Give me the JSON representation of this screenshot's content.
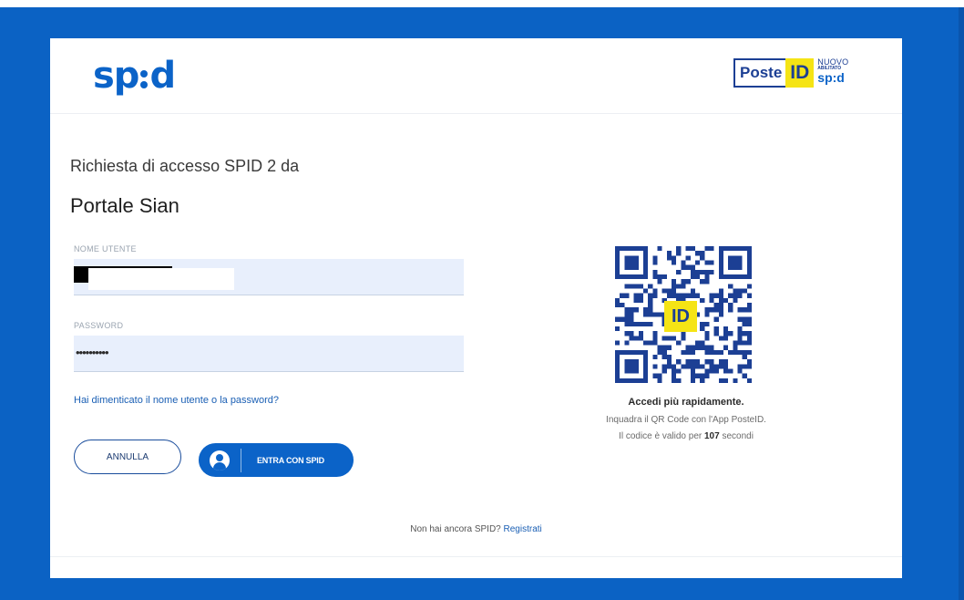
{
  "header": {
    "spid_logo": "sp:d",
    "poste_badge": {
      "brand": "Poste",
      "id": "ID",
      "nuovo": "NUOVO",
      "abilitato": "ABILITATO",
      "spid": "sp:d"
    }
  },
  "request": {
    "title": "Richiesta di accesso SPID 2 da",
    "service": "Portale Sian"
  },
  "form": {
    "username_label": "NOME UTENTE",
    "username_value": "",
    "password_label": "PASSWORD",
    "password_value": "••••••••••",
    "forgot_link": "Hai dimenticato il nome utente o la password?",
    "cancel_label": "ANNULLA",
    "enter_label": "ENTRA CON SPID"
  },
  "qr": {
    "badge": "ID",
    "title": "Accedi più rapidamente.",
    "line1": "Inquadra il QR Code con l'App PosteID.",
    "line2_prefix": "Il codice è valido per ",
    "seconds": "107",
    "line2_suffix": " secondi"
  },
  "footer": {
    "prompt": "Non hai ancora SPID? ",
    "register_link": "Registrati"
  },
  "colors": {
    "background": "#0b62c4",
    "spid_blue": "#0b63c8",
    "poste_navy": "#1c3f94",
    "poste_yellow": "#f5e415",
    "input_bg": "#e8effc",
    "link": "#1a5fb4"
  }
}
